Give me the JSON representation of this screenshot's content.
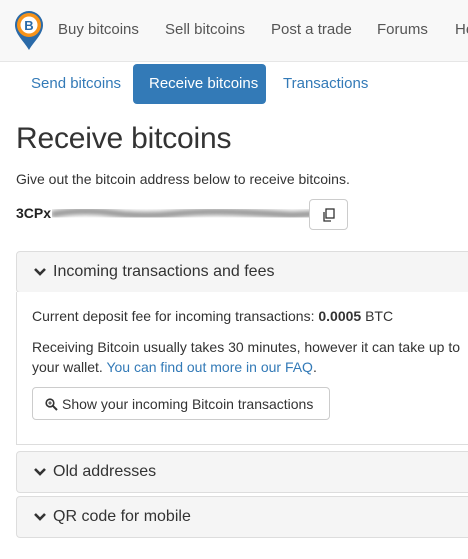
{
  "nav": {
    "items": [
      "Buy bitcoins",
      "Sell bitcoins",
      "Post a trade",
      "Forums",
      "He"
    ]
  },
  "tabs": [
    "Send bitcoins",
    "Receive bitcoins",
    "Transactions"
  ],
  "active_tab": "Receive bitcoins",
  "page": {
    "title": "Receive bitcoins",
    "subtitle": "Give out the bitcoin address below to receive bitcoins.",
    "address_prefix": "3CPx"
  },
  "incoming_panel": {
    "title": "Incoming transactions and fees",
    "fee_text": "Current deposit fee for incoming transactions: ",
    "fee_value": "0.0005",
    "fee_unit": " BTC",
    "info_line1": "Receiving Bitcoin usually takes 30 minutes, however it can take up to",
    "info_line2": "your wallet. ",
    "faq_link": "You can find out more in our FAQ",
    "info_end": ".",
    "show_button": "Show your incoming Bitcoin transactions"
  },
  "old_addresses_panel": {
    "title": "Old addresses"
  },
  "qr_panel": {
    "title": "QR code for mobile"
  },
  "colors": {
    "accent": "#337ab7",
    "logo_orange": "#f7931a",
    "logo_blue": "#2a6aa8"
  },
  "icons": {
    "logo": "bitcoin-location-pin",
    "copy": "copy-icon",
    "chevron": "chevron-down-icon",
    "search": "magnifier-icon"
  }
}
